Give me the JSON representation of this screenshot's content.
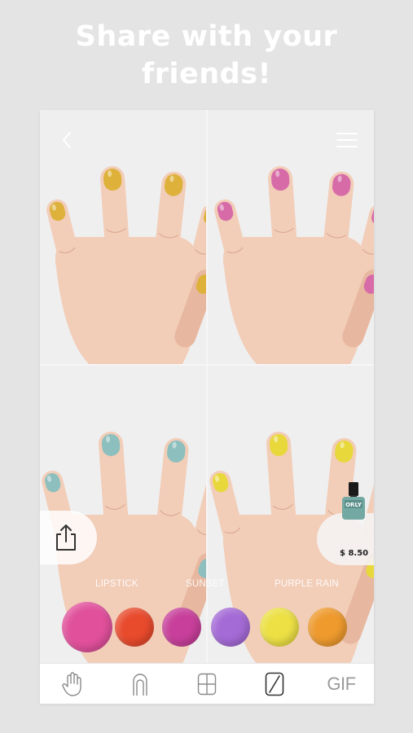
{
  "headline": {
    "line1": "Share with your",
    "line2": "friends!"
  },
  "swatch_labels": [
    "LIPSTICK",
    "SUNSET",
    "PURPLE RAIN"
  ],
  "product": {
    "price": "$ 8.50",
    "brand": "ORLY"
  },
  "tabs": [
    {
      "id": "hand",
      "icon": "hand-icon"
    },
    {
      "id": "nail",
      "icon": "nail-shape-icon"
    },
    {
      "id": "grid",
      "icon": "grid-icon"
    },
    {
      "id": "compare",
      "icon": "compare-icon",
      "selected": true
    },
    {
      "id": "gif",
      "label": "GIF"
    }
  ],
  "swatches": [
    {
      "name": "pink",
      "color": "#e0509b"
    },
    {
      "name": "red-orange",
      "color": "#e84a2c"
    },
    {
      "name": "magenta",
      "color": "#c73f9a"
    },
    {
      "name": "lavender",
      "color": "#a46ad6"
    },
    {
      "name": "yellow",
      "color": "#ece045"
    },
    {
      "name": "orange",
      "color": "#ee9a2d"
    }
  ],
  "nail_colors": {
    "top_left": "#ddb13a",
    "top_right": "#d76ba8",
    "bottom_left": "#8cbfbd",
    "bottom_right": "#e8d83c"
  }
}
